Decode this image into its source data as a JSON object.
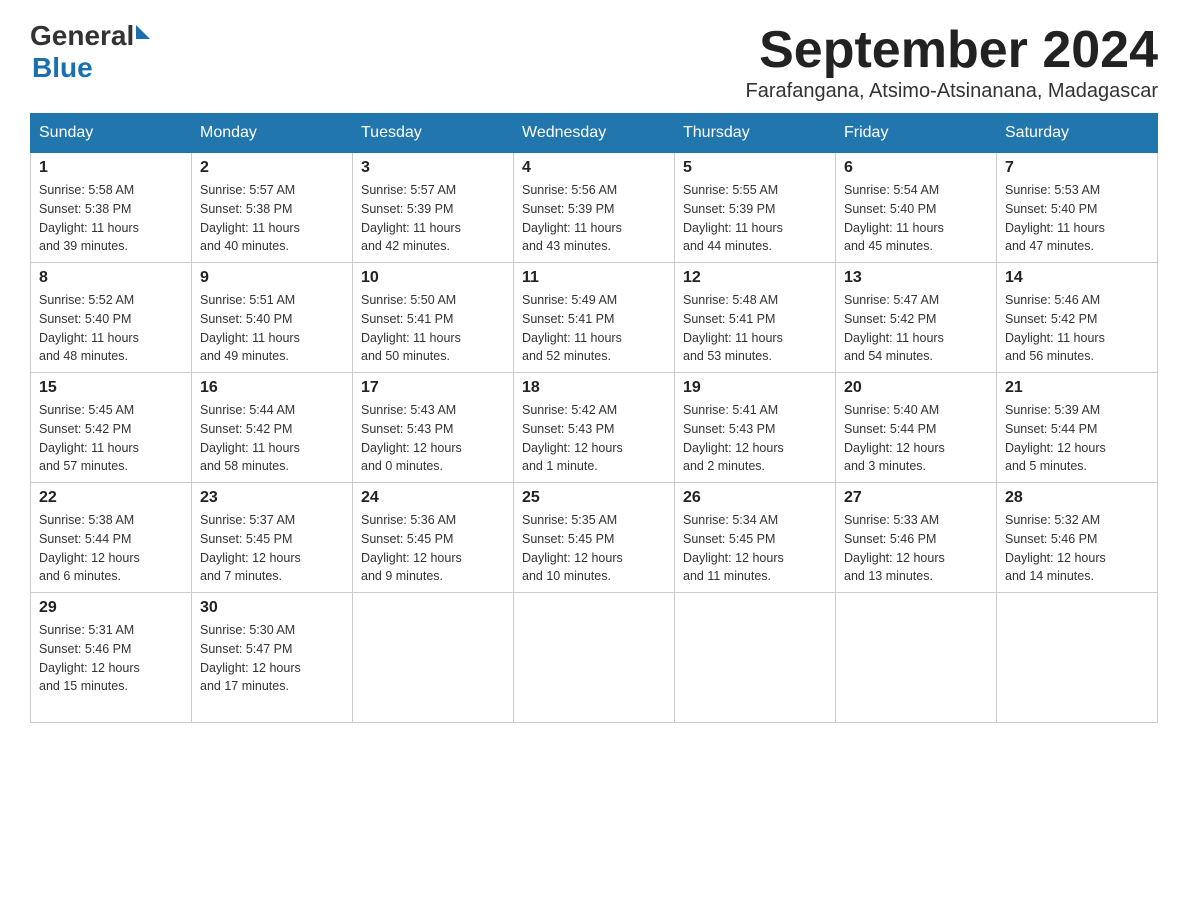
{
  "header": {
    "logo_text1": "General",
    "logo_text2": "Blue",
    "month_title": "September 2024",
    "location": "Farafangana, Atsimo-Atsinanana, Madagascar"
  },
  "days_of_week": [
    "Sunday",
    "Monday",
    "Tuesday",
    "Wednesday",
    "Thursday",
    "Friday",
    "Saturday"
  ],
  "weeks": [
    [
      {
        "day": "1",
        "sunrise": "5:58 AM",
        "sunset": "5:38 PM",
        "daylight": "11 hours and 39 minutes."
      },
      {
        "day": "2",
        "sunrise": "5:57 AM",
        "sunset": "5:38 PM",
        "daylight": "11 hours and 40 minutes."
      },
      {
        "day": "3",
        "sunrise": "5:57 AM",
        "sunset": "5:39 PM",
        "daylight": "11 hours and 42 minutes."
      },
      {
        "day": "4",
        "sunrise": "5:56 AM",
        "sunset": "5:39 PM",
        "daylight": "11 hours and 43 minutes."
      },
      {
        "day": "5",
        "sunrise": "5:55 AM",
        "sunset": "5:39 PM",
        "daylight": "11 hours and 44 minutes."
      },
      {
        "day": "6",
        "sunrise": "5:54 AM",
        "sunset": "5:40 PM",
        "daylight": "11 hours and 45 minutes."
      },
      {
        "day": "7",
        "sunrise": "5:53 AM",
        "sunset": "5:40 PM",
        "daylight": "11 hours and 47 minutes."
      }
    ],
    [
      {
        "day": "8",
        "sunrise": "5:52 AM",
        "sunset": "5:40 PM",
        "daylight": "11 hours and 48 minutes."
      },
      {
        "day": "9",
        "sunrise": "5:51 AM",
        "sunset": "5:40 PM",
        "daylight": "11 hours and 49 minutes."
      },
      {
        "day": "10",
        "sunrise": "5:50 AM",
        "sunset": "5:41 PM",
        "daylight": "11 hours and 50 minutes."
      },
      {
        "day": "11",
        "sunrise": "5:49 AM",
        "sunset": "5:41 PM",
        "daylight": "11 hours and 52 minutes."
      },
      {
        "day": "12",
        "sunrise": "5:48 AM",
        "sunset": "5:41 PM",
        "daylight": "11 hours and 53 minutes."
      },
      {
        "day": "13",
        "sunrise": "5:47 AM",
        "sunset": "5:42 PM",
        "daylight": "11 hours and 54 minutes."
      },
      {
        "day": "14",
        "sunrise": "5:46 AM",
        "sunset": "5:42 PM",
        "daylight": "11 hours and 56 minutes."
      }
    ],
    [
      {
        "day": "15",
        "sunrise": "5:45 AM",
        "sunset": "5:42 PM",
        "daylight": "11 hours and 57 minutes."
      },
      {
        "day": "16",
        "sunrise": "5:44 AM",
        "sunset": "5:42 PM",
        "daylight": "11 hours and 58 minutes."
      },
      {
        "day": "17",
        "sunrise": "5:43 AM",
        "sunset": "5:43 PM",
        "daylight": "12 hours and 0 minutes."
      },
      {
        "day": "18",
        "sunrise": "5:42 AM",
        "sunset": "5:43 PM",
        "daylight": "12 hours and 1 minute."
      },
      {
        "day": "19",
        "sunrise": "5:41 AM",
        "sunset": "5:43 PM",
        "daylight": "12 hours and 2 minutes."
      },
      {
        "day": "20",
        "sunrise": "5:40 AM",
        "sunset": "5:44 PM",
        "daylight": "12 hours and 3 minutes."
      },
      {
        "day": "21",
        "sunrise": "5:39 AM",
        "sunset": "5:44 PM",
        "daylight": "12 hours and 5 minutes."
      }
    ],
    [
      {
        "day": "22",
        "sunrise": "5:38 AM",
        "sunset": "5:44 PM",
        "daylight": "12 hours and 6 minutes."
      },
      {
        "day": "23",
        "sunrise": "5:37 AM",
        "sunset": "5:45 PM",
        "daylight": "12 hours and 7 minutes."
      },
      {
        "day": "24",
        "sunrise": "5:36 AM",
        "sunset": "5:45 PM",
        "daylight": "12 hours and 9 minutes."
      },
      {
        "day": "25",
        "sunrise": "5:35 AM",
        "sunset": "5:45 PM",
        "daylight": "12 hours and 10 minutes."
      },
      {
        "day": "26",
        "sunrise": "5:34 AM",
        "sunset": "5:45 PM",
        "daylight": "12 hours and 11 minutes."
      },
      {
        "day": "27",
        "sunrise": "5:33 AM",
        "sunset": "5:46 PM",
        "daylight": "12 hours and 13 minutes."
      },
      {
        "day": "28",
        "sunrise": "5:32 AM",
        "sunset": "5:46 PM",
        "daylight": "12 hours and 14 minutes."
      }
    ],
    [
      {
        "day": "29",
        "sunrise": "5:31 AM",
        "sunset": "5:46 PM",
        "daylight": "12 hours and 15 minutes."
      },
      {
        "day": "30",
        "sunrise": "5:30 AM",
        "sunset": "5:47 PM",
        "daylight": "12 hours and 17 minutes."
      },
      null,
      null,
      null,
      null,
      null
    ]
  ]
}
